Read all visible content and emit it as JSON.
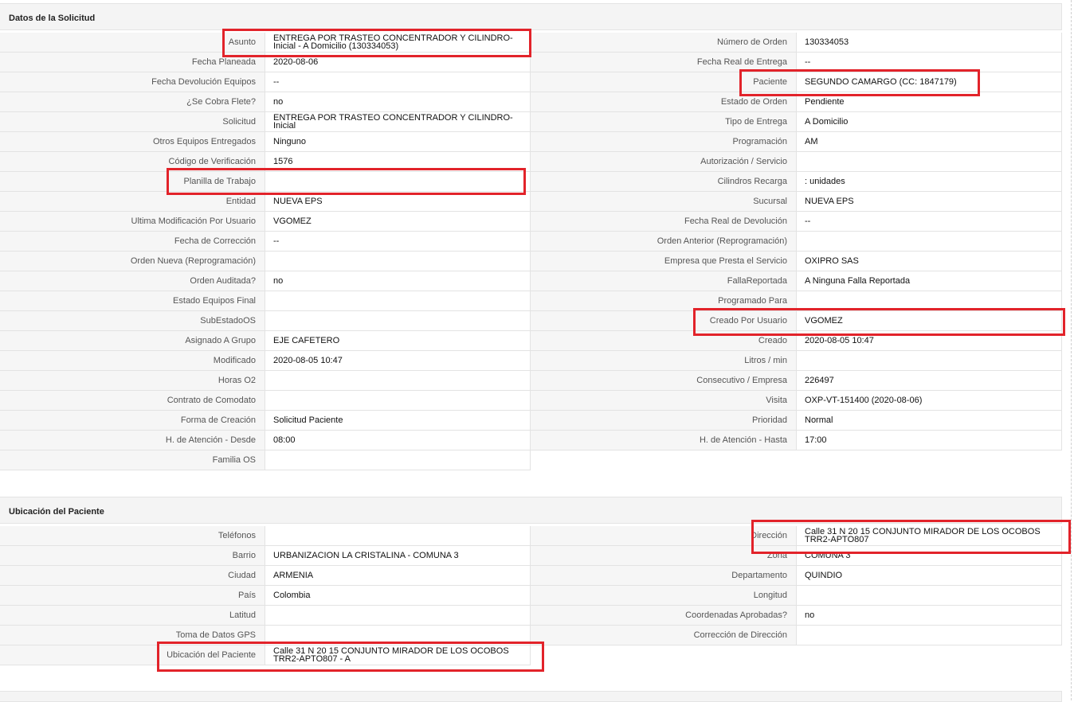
{
  "section1": {
    "title": "Datos de la Solicitud",
    "left": [
      {
        "label": "Asunto",
        "value": "ENTREGA POR TRASTEO CONCENTRADOR Y CILINDRO-Inicial - A Domicilio (130334053)"
      },
      {
        "label": "Fecha Planeada",
        "value": "2020-08-06"
      },
      {
        "label": "Fecha Devolución Equipos",
        "value": "--"
      },
      {
        "label": "¿Se Cobra Flete?",
        "value": "no"
      },
      {
        "label": "Solicitud",
        "value": "ENTREGA POR TRASTEO CONCENTRADOR Y CILINDRO-Inicial"
      },
      {
        "label": "Otros Equipos Entregados",
        "value": "Ninguno"
      },
      {
        "label": "Código de Verificación",
        "value": "1576"
      },
      {
        "label": "Planilla de Trabajo",
        "value": ""
      },
      {
        "label": "Entidad",
        "value": "NUEVA EPS"
      },
      {
        "label": "Ultima Modificación Por Usuario",
        "value": "VGOMEZ"
      },
      {
        "label": "Fecha de Corrección",
        "value": "--"
      },
      {
        "label": "Orden Nueva (Reprogramación)",
        "value": ""
      },
      {
        "label": "Orden Auditada?",
        "value": "no"
      },
      {
        "label": "Estado Equipos Final",
        "value": ""
      },
      {
        "label": "SubEstadoOS",
        "value": ""
      },
      {
        "label": "Asignado A Grupo",
        "value": "EJE CAFETERO"
      },
      {
        "label": "Modificado",
        "value": "2020-08-05 10:47"
      },
      {
        "label": "Horas O2",
        "value": ""
      },
      {
        "label": "Contrato de Comodato",
        "value": ""
      },
      {
        "label": "Forma de Creación",
        "value": "Solicitud Paciente"
      },
      {
        "label": "H. de Atención - Desde",
        "value": "08:00"
      },
      {
        "label": "Familia OS",
        "value": ""
      }
    ],
    "right": [
      {
        "label": "Número de Orden",
        "value": "130334053"
      },
      {
        "label": "Fecha Real de Entrega",
        "value": "--"
      },
      {
        "label": "Paciente",
        "value": "SEGUNDO CAMARGO (CC: 1847179)"
      },
      {
        "label": "Estado de Orden",
        "value": "Pendiente"
      },
      {
        "label": "Tipo de Entrega",
        "value": "A Domicilio"
      },
      {
        "label": "Programación",
        "value": "AM"
      },
      {
        "label": "Autorización / Servicio",
        "value": ""
      },
      {
        "label": "Cilindros Recarga",
        "value": ": unidades"
      },
      {
        "label": "Sucursal",
        "value": "NUEVA EPS"
      },
      {
        "label": "Fecha Real de Devolución",
        "value": "--"
      },
      {
        "label": "Orden Anterior (Reprogramación)",
        "value": ""
      },
      {
        "label": "Empresa que Presta el Servicio",
        "value": "OXIPRO SAS"
      },
      {
        "label": "FallaReportada",
        "value": "A Ninguna Falla Reportada"
      },
      {
        "label": "Programado Para",
        "value": ""
      },
      {
        "label": "Creado Por Usuario",
        "value": "VGOMEZ"
      },
      {
        "label": "Creado",
        "value": "2020-08-05 10:47"
      },
      {
        "label": "Litros / min",
        "value": ""
      },
      {
        "label": "Consecutivo / Empresa",
        "value": "226497"
      },
      {
        "label": "Visita",
        "value": "OXP-VT-151400 (2020-08-06)"
      },
      {
        "label": "Prioridad",
        "value": "Normal"
      },
      {
        "label": "H. de Atención - Hasta",
        "value": "17:00"
      }
    ]
  },
  "section2": {
    "title": "Ubicación del Paciente",
    "left": [
      {
        "label": "Teléfonos",
        "value": ""
      },
      {
        "label": "Barrio",
        "value": "URBANIZACION LA CRISTALINA - COMUNA 3"
      },
      {
        "label": "Ciudad",
        "value": "ARMENIA"
      },
      {
        "label": "País",
        "value": "Colombia"
      },
      {
        "label": "Latitud",
        "value": ""
      },
      {
        "label": "Toma de Datos GPS",
        "value": ""
      },
      {
        "label": "Ubicación del Paciente",
        "value": "Calle 31 N 20 15 CONJUNTO MIRADOR DE LOS OCOBOS TRR2-APTO807 - A"
      }
    ],
    "right": [
      {
        "label": "Dirección",
        "value": "Calle 31 N 20 15 CONJUNTO MIRADOR DE LOS OCOBOS TRR2-APTO807"
      },
      {
        "label": "Zona",
        "value": "COMUNA 3"
      },
      {
        "label": "Departamento",
        "value": "QUINDIO"
      },
      {
        "label": "Longitud",
        "value": ""
      },
      {
        "label": "Coordenadas Aprobadas?",
        "value": "no"
      },
      {
        "label": "Corrección de Dirección",
        "value": ""
      }
    ]
  },
  "highlight_color": "#e2232a"
}
